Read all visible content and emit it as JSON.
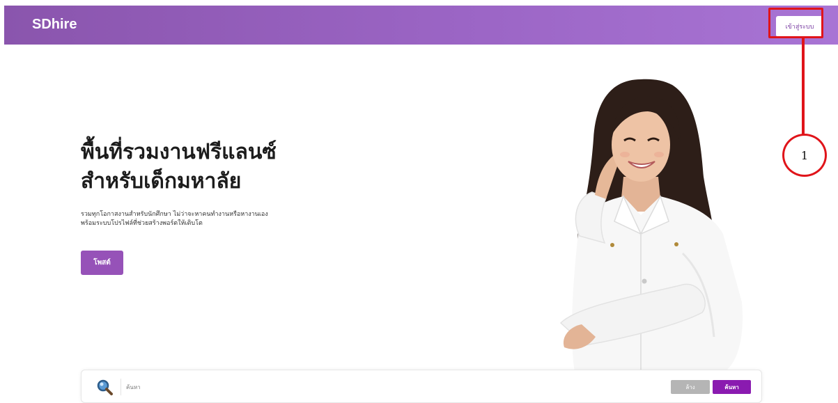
{
  "navbar": {
    "brand": "SDhire",
    "login_label": "เข้าสู่ระบบ",
    "background_color": "#9b65c5"
  },
  "annotation": {
    "marker_label": "1",
    "color": "#e0141a"
  },
  "hero": {
    "title_line1": "พื้นที่รวมงานฟรีแลนซ์",
    "title_line2": "สำหรับเด็กมหาลัย",
    "description_line1": "รวมทุกโอกาสงานสำหรับนักศึกษา ไม่ว่าจะหาคนทำงานหรือหางานเอง",
    "description_line2": "พร้อมระบบโปรไฟล์ที่ช่วยสร้างพอร์ตให้เติบโต",
    "post_button_label": "โพสต์",
    "accent_color": "#9652b8"
  },
  "search": {
    "placeholder": "ค้นหา",
    "value": "",
    "clear_label": "ล้าง",
    "submit_label": "ค้นหา",
    "icon": "magnifier-icon"
  },
  "illustration": {
    "icon": "student-portrait"
  }
}
